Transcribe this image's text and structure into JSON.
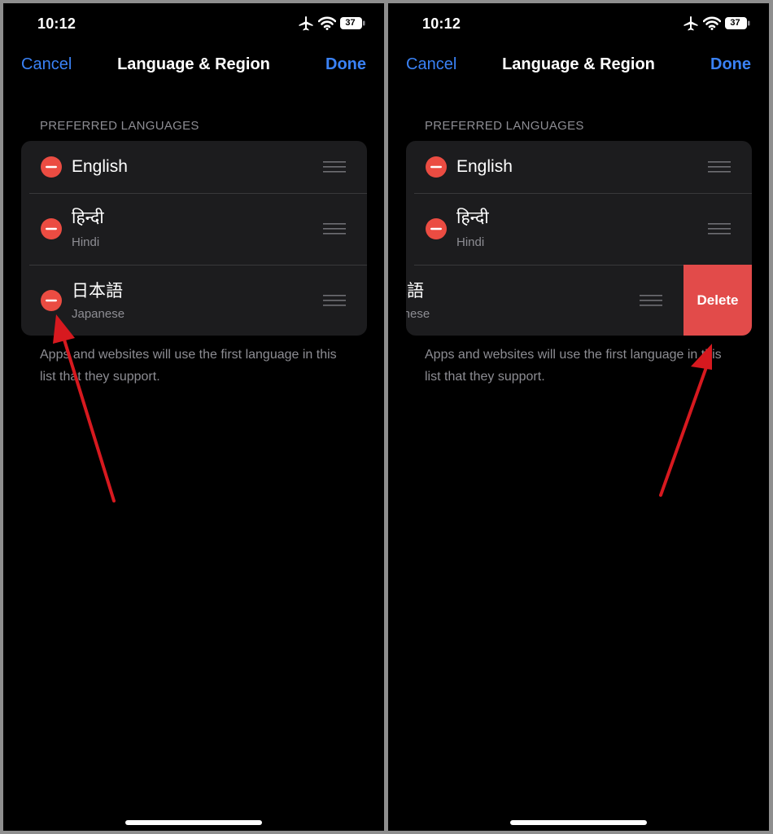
{
  "status": {
    "time": "10:12",
    "battery": "37"
  },
  "nav": {
    "cancel": "Cancel",
    "title": "Language & Region",
    "done": "Done"
  },
  "section_header": "PREFERRED LANGUAGES",
  "languages": [
    {
      "native": "English",
      "english": ""
    },
    {
      "native": "हिन्दी",
      "english": "Hindi"
    },
    {
      "native": "日本語",
      "english": "Japanese"
    }
  ],
  "swipe_row": {
    "native": "本語",
    "english": "panese"
  },
  "delete_label": "Delete",
  "footer": "Apps and websites will use the first language in this list that they support.",
  "colors": {
    "accent": "#3a82f6",
    "delete": "#e24b4a",
    "minus": "#eb4c42",
    "annotation_arrow": "#d7191f"
  },
  "icons": [
    "airplane-icon",
    "wifi-icon",
    "battery-icon",
    "minus-circle-icon",
    "reorder-icon",
    "annotation-arrow"
  ]
}
